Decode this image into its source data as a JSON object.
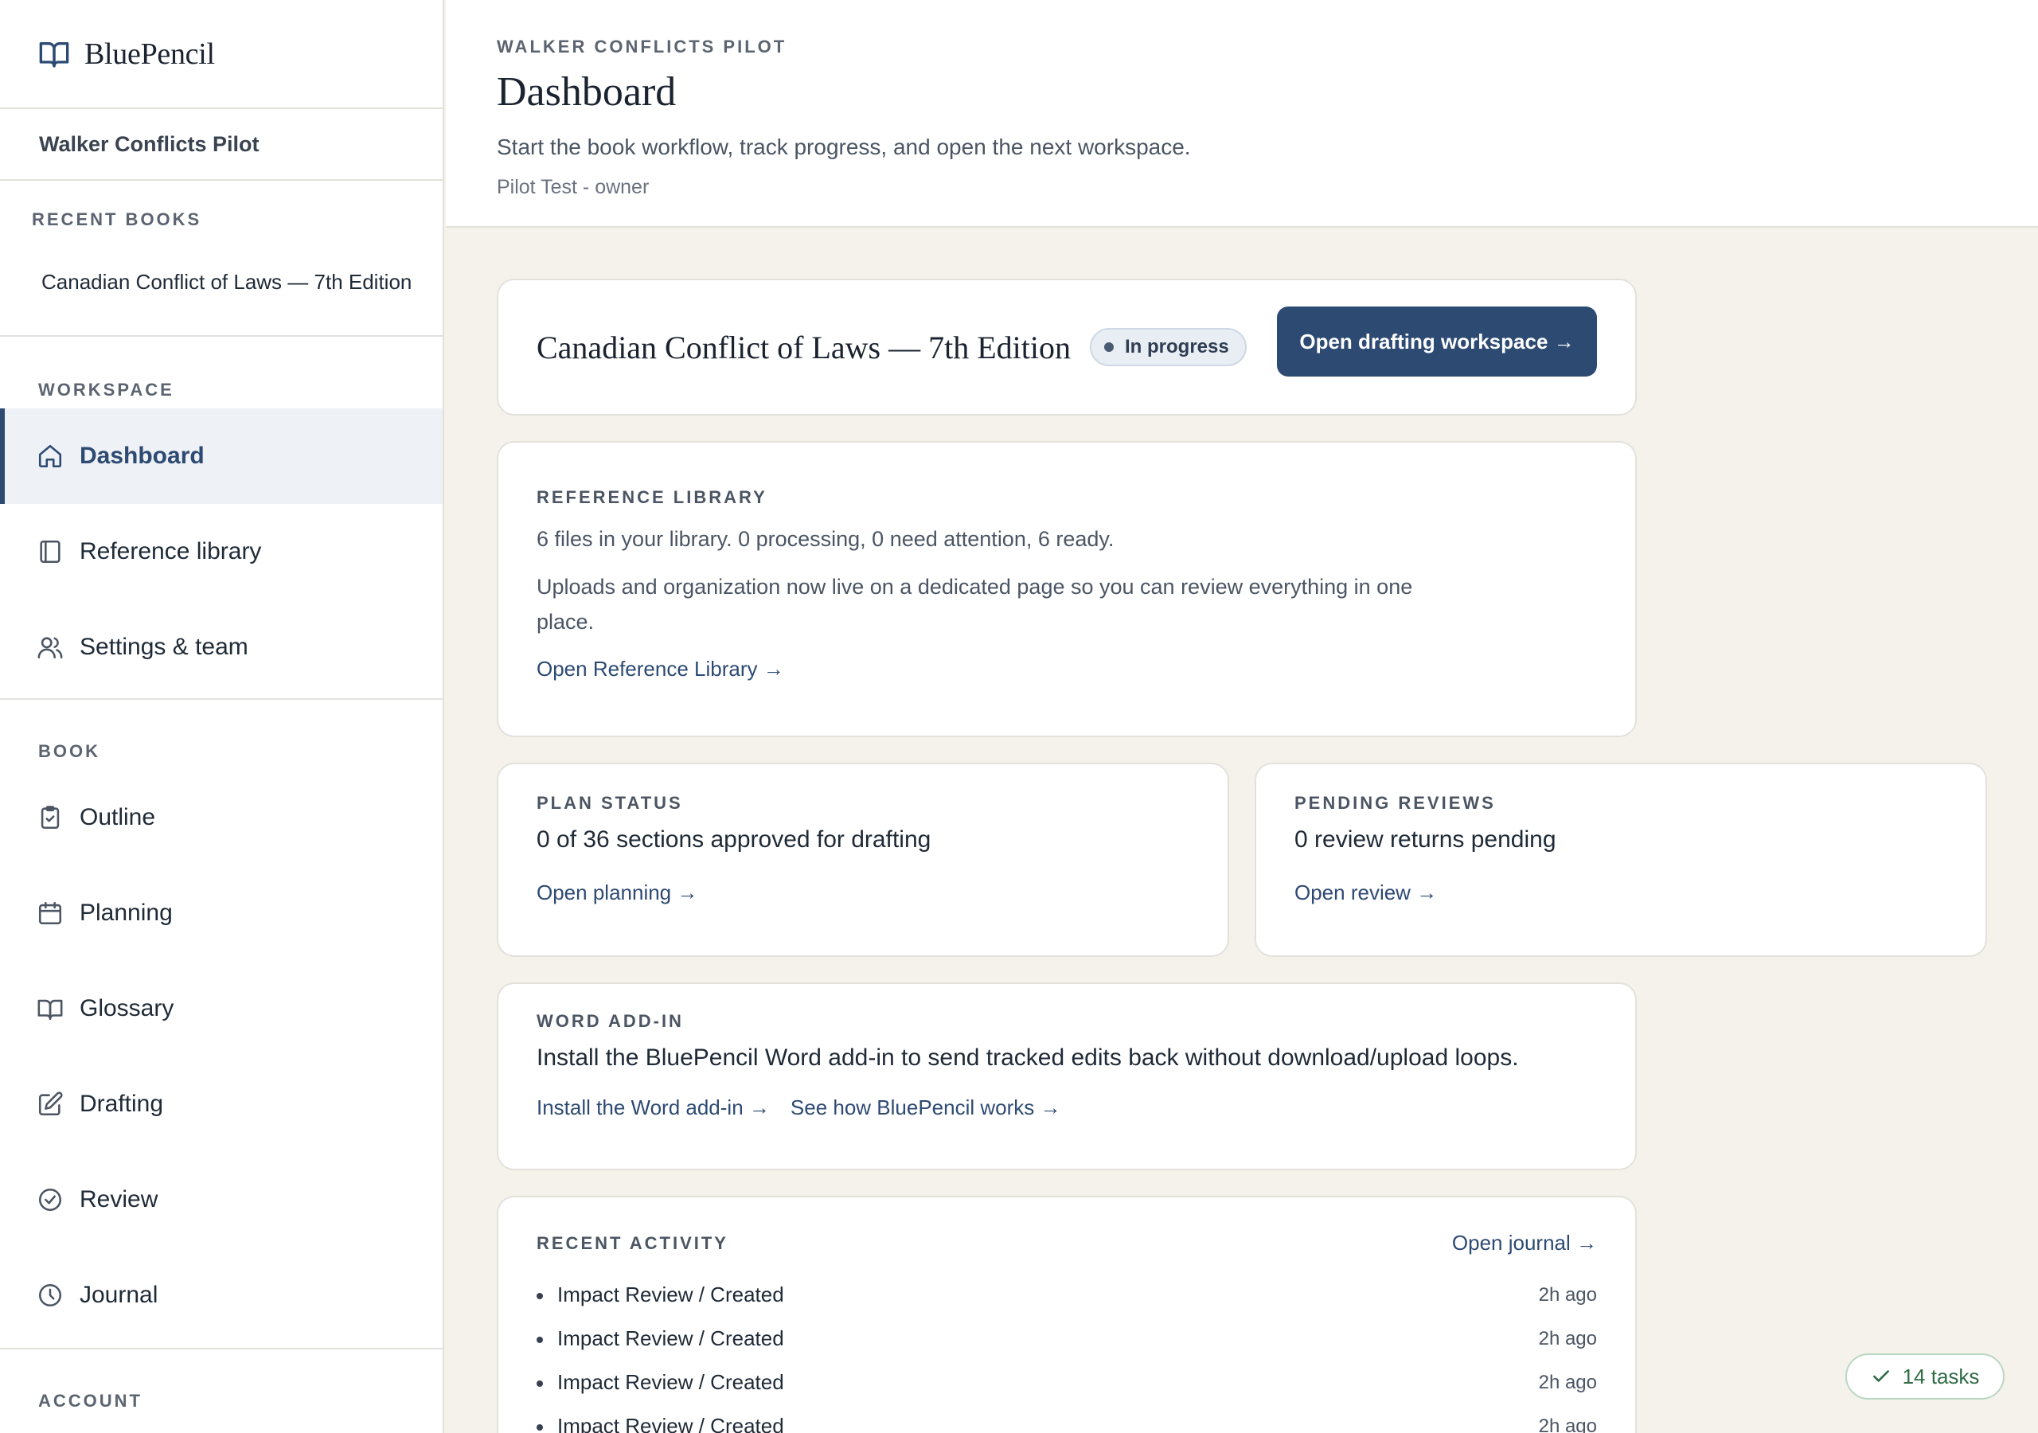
{
  "brand": {
    "name": "BluePencil",
    "icon": "open-book-icon"
  },
  "sidebar": {
    "project_name": "Walker Conflicts Pilot",
    "recent_books_label": "RECENT BOOKS",
    "recent_books": [
      "Canadian Conflict of Laws — 7th Edition"
    ],
    "workspace_label": "WORKSPACE",
    "workspace_items": [
      {
        "label": "Dashboard",
        "icon": "home-icon",
        "active": true
      },
      {
        "label": "Reference library",
        "icon": "notebook-icon"
      },
      {
        "label": "Settings & team",
        "icon": "users-icon"
      }
    ],
    "book_label": "BOOK",
    "book_items": [
      {
        "label": "Outline",
        "icon": "clipboard-icon"
      },
      {
        "label": "Planning",
        "icon": "calendar-icon"
      },
      {
        "label": "Glossary",
        "icon": "book-open-icon"
      },
      {
        "label": "Drafting",
        "icon": "edit-icon"
      },
      {
        "label": "Review",
        "icon": "check-circle-icon"
      },
      {
        "label": "Journal",
        "icon": "clock-icon"
      }
    ],
    "account_label": "ACCOUNT"
  },
  "header": {
    "eyebrow": "WALKER CONFLICTS PILOT",
    "title": "Dashboard",
    "subtitle": "Start the book workflow, track progress, and open the next workspace.",
    "meta": "Pilot Test - owner"
  },
  "book_card": {
    "title": "Canadian Conflict of Laws — 7th Edition",
    "status": "In progress",
    "primary_action": "Open drafting workspace →"
  },
  "reference": {
    "label": "REFERENCE LIBRARY",
    "summary": "6 files in your library. 0 processing, 0 need attention, 6 ready.",
    "description": "Uploads and organization now live on a dedicated page so you can review everything in one place.",
    "link": "Open Reference Library →"
  },
  "plan": {
    "label": "PLAN STATUS",
    "text": "0 of 36 sections approved for drafting",
    "link": "Open planning →"
  },
  "reviews": {
    "label": "PENDING REVIEWS",
    "text": "0 review returns pending",
    "link": "Open review →"
  },
  "word_addin": {
    "label": "WORD ADD-IN",
    "text": "Install the BluePencil Word add-in to send tracked edits back without download/upload loops.",
    "install_link": "Install the Word add-in →",
    "how_link": "See how BluePencil works →"
  },
  "activity": {
    "label": "RECENT ACTIVITY",
    "journal_link": "Open journal →",
    "items": [
      {
        "text": "Impact Review / Created",
        "time": "2h ago"
      },
      {
        "text": "Impact Review / Created",
        "time": "2h ago"
      },
      {
        "text": "Impact Review / Created",
        "time": "2h ago"
      },
      {
        "text": "Impact Review / Created",
        "time": "2h ago"
      }
    ]
  },
  "tasks": {
    "label": "14 tasks"
  },
  "colors": {
    "accent": "#2d4a73",
    "background": "#f5f2ec",
    "success": "#2f6b44"
  }
}
